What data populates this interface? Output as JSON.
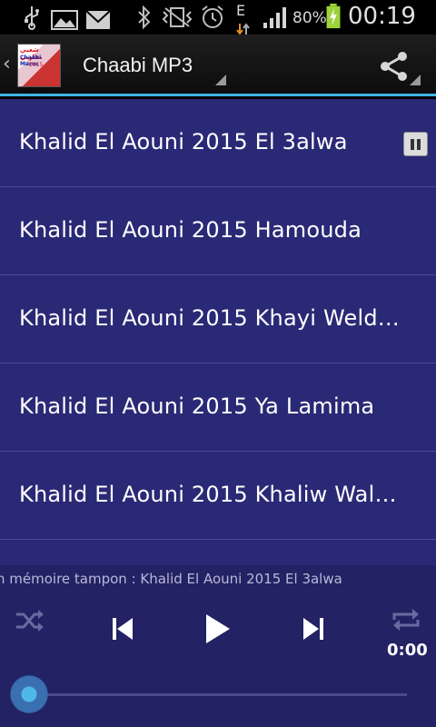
{
  "status_bar": {
    "battery": "80%",
    "time": "00:19",
    "network": "E",
    "icons": [
      "usb-icon",
      "image-icon",
      "mail-icon",
      "bluetooth-icon",
      "vibrate-icon",
      "alarm-icon",
      "data-transfer-icon",
      "signal-icon",
      "battery-charging-icon"
    ]
  },
  "action_bar": {
    "back_icon": "chevron-left-icon",
    "logo_lines": [
      "شعبي مغاربي",
      "Chaabi Maroc",
      "2015"
    ],
    "title": "Chaabi MP3",
    "share_icon": "share-icon"
  },
  "songs": [
    {
      "title": "Khalid El Aouni 2015 El 3alwa",
      "playing": true
    },
    {
      "title": "Khalid El Aouni 2015 Hamouda",
      "playing": false
    },
    {
      "title": "Khalid El Aouni 2015 Khayi Weld…",
      "playing": false
    },
    {
      "title": "Khalid El Aouni 2015 Ya Lamima",
      "playing": false
    },
    {
      "title": "Khalid El Aouni 2015 Khaliw Wal…",
      "playing": false
    }
  ],
  "player": {
    "status_text": "n mémoire tampon : Khalid El Aouni 2015 El 3alwa",
    "elapsed": "0:00",
    "progress": 0,
    "colors": {
      "list_bg": "#2a2976",
      "player_bg": "#222265",
      "accent": "#3fb4e6"
    }
  }
}
